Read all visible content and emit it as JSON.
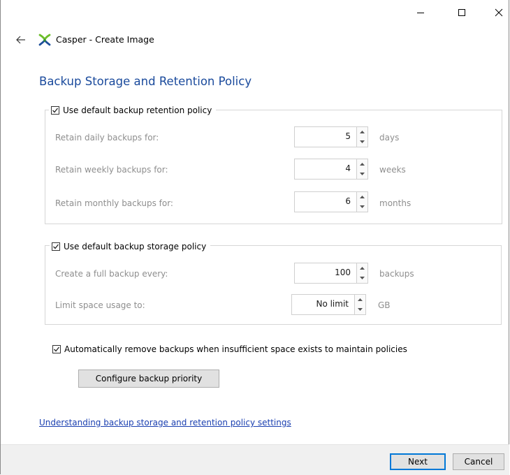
{
  "window": {
    "app_name": "Casper",
    "title": "Casper  - Create Image"
  },
  "page": {
    "title": "Backup Storage and Retention Policy"
  },
  "retention": {
    "checkbox_label": "Use default backup retention policy",
    "checked": true,
    "rows": [
      {
        "label": "Retain daily backups for:",
        "value": "5",
        "unit": "days"
      },
      {
        "label": "Retain weekly backups for:",
        "value": "4",
        "unit": "weeks"
      },
      {
        "label": "Retain monthly backups for:",
        "value": "6",
        "unit": "months"
      }
    ]
  },
  "storage": {
    "checkbox_label": "Use default backup storage policy",
    "checked": true,
    "rows": [
      {
        "label": "Create a full backup every:",
        "value": "100",
        "unit": "backups"
      },
      {
        "label": "Limit space usage to:",
        "value": "No limit",
        "unit": "GB"
      }
    ]
  },
  "auto_remove": {
    "label": "Automatically remove backups when insufficient space exists to maintain policies",
    "checked": true
  },
  "buttons": {
    "configure_priority": "Configure backup priority",
    "next": "Next",
    "cancel": "Cancel"
  },
  "help_link": "Understanding backup storage and retention policy settings",
  "colors": {
    "title_blue": "#1a4a9c",
    "link_blue": "#1a3fb0",
    "disabled_text": "#8e8e8e",
    "focus_border": "#0078d7"
  }
}
